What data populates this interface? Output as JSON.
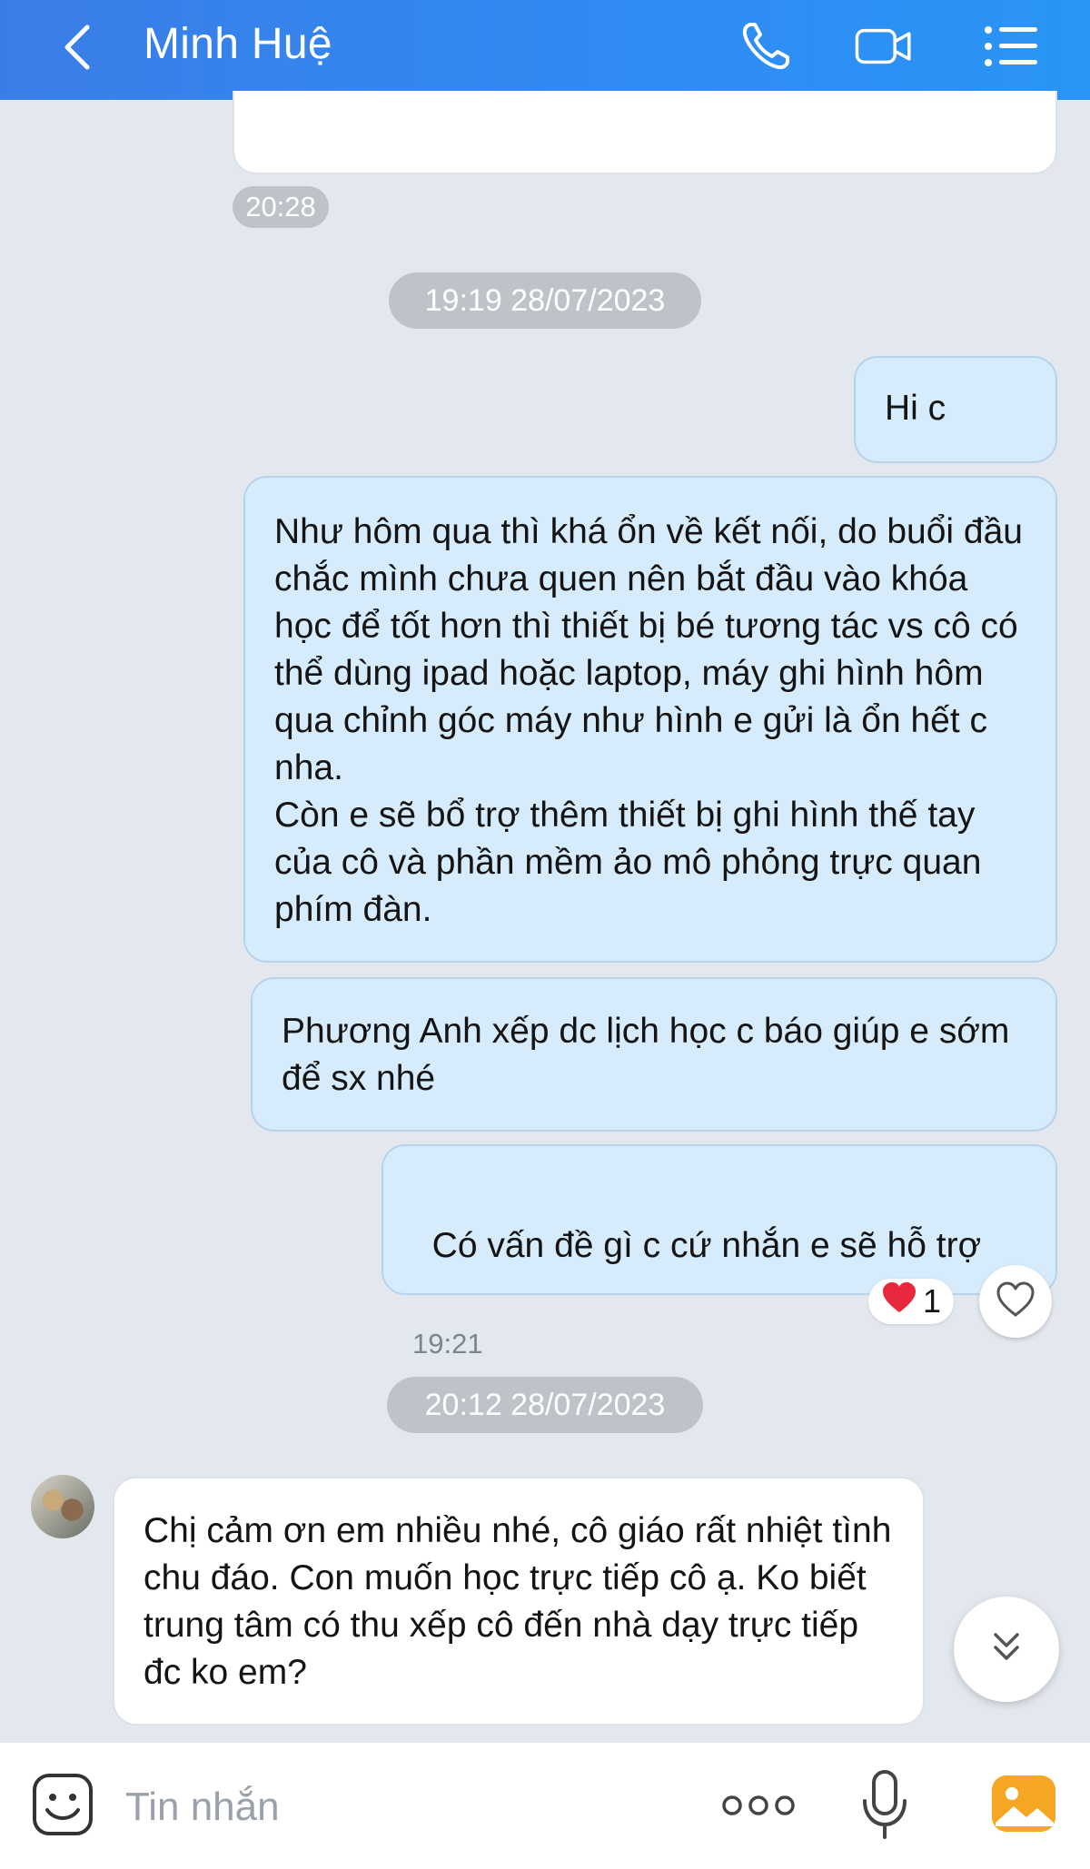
{
  "header": {
    "title": "Minh Huệ"
  },
  "messages": {
    "prev_time": "20:28",
    "date1": "19:19 28/07/2023",
    "m1": "Hi c",
    "m2": "Như hôm qua thì khá ổn về kết nối, do buổi đầu chắc mình chưa quen nên bắt đầu vào khóa học để tốt hơn thì thiết bị bé tương tác vs cô có thể dùng ipad hoặc laptop, máy ghi hình hôm qua chỉnh góc máy như hình e gửi là ổn hết c nha.\nCòn e sẽ bổ trợ thêm thiết bị ghi hình thế tay của cô và phần mềm ảo mô phỏng trực quan phím đàn.",
    "m3": "Phương Anh xếp dc lịch học c báo giúp e sớm để sx nhé",
    "m4": "Có vấn đề gì c cứ nhắn e sẽ hỗ trợ",
    "m4_time": "19:21",
    "reaction_count": "1",
    "date2": "20:12 28/07/2023",
    "m5": "Chị cảm ơn em nhiều nhé, cô giáo rất nhiệt tình chu đáo. Con muốn học trực tiếp cô ạ. Ko biết trung tâm có thu xếp cô đến nhà dạy trực tiếp đc ko em?"
  },
  "composer": {
    "placeholder": "Tin nhắn"
  },
  "icons": [
    "back-icon",
    "phone-icon",
    "video-call-icon",
    "menu-icon",
    "heart-icon",
    "scroll-down-icon",
    "sticker-icon",
    "more-icon",
    "mic-icon",
    "photo-icon"
  ],
  "colors": {
    "header": "#2f8cf3",
    "outgoing_bubble": "#d6ebfb",
    "incoming_bubble": "#ffffff",
    "background": "#e3e8ef"
  }
}
